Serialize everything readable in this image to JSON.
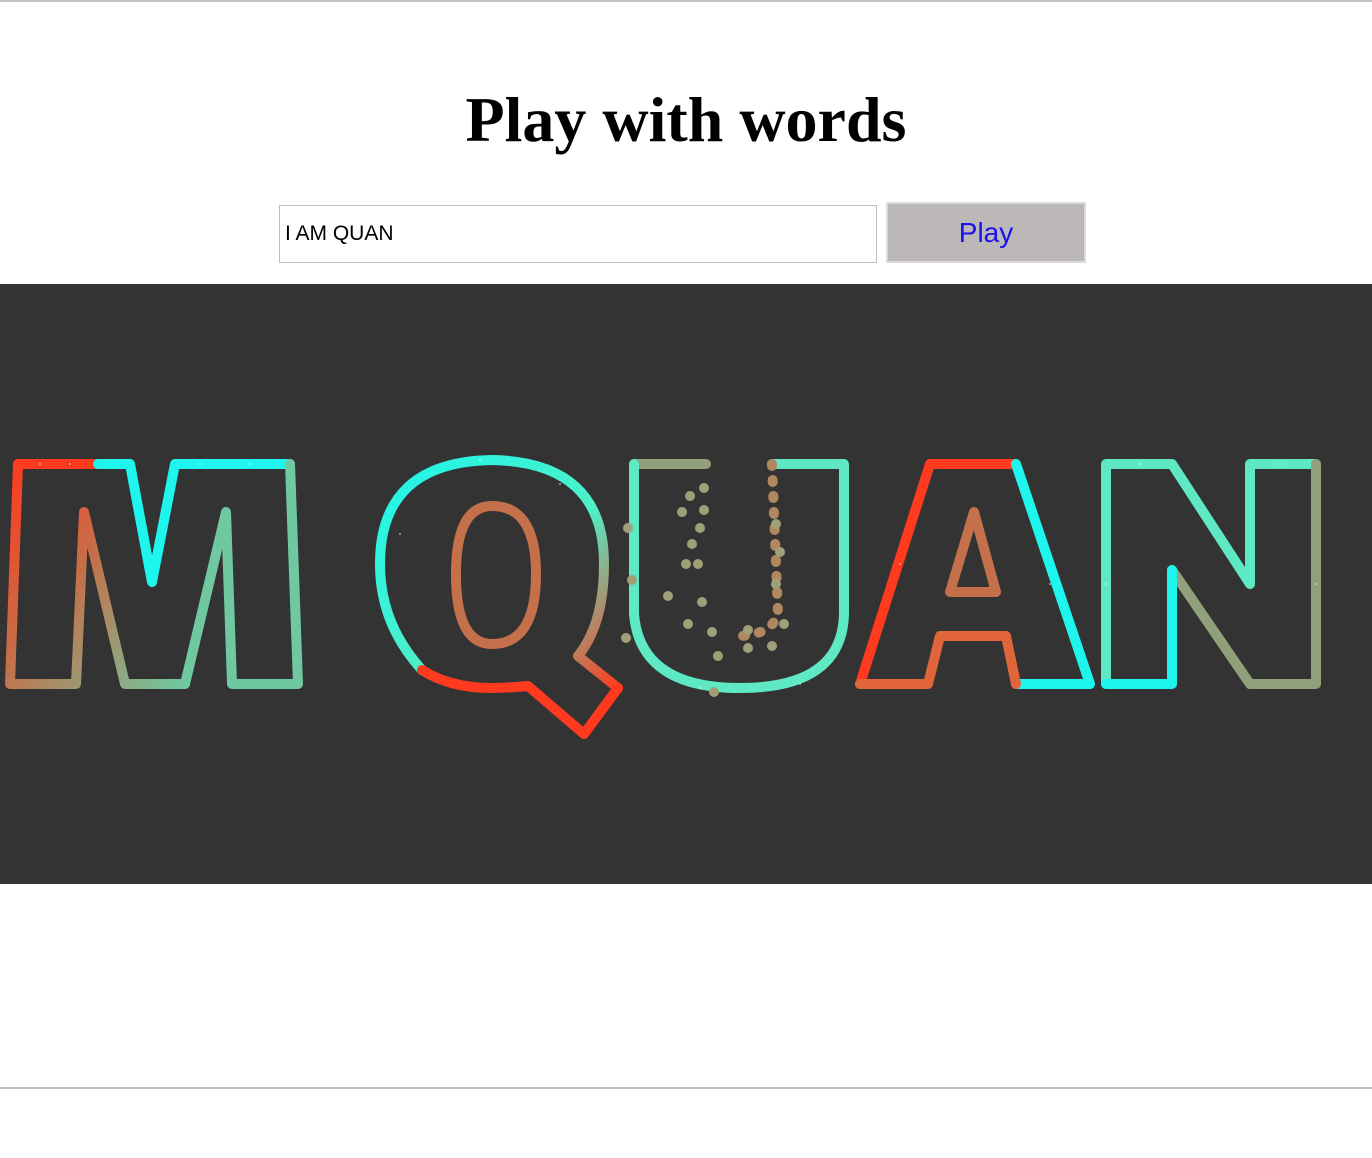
{
  "page": {
    "title": "Play with words"
  },
  "form": {
    "input_value": "I AM QUAN",
    "play_label": "Play"
  },
  "canvas": {
    "background": "#333333",
    "rendered_text": "I AM QUAN",
    "particle_colors": [
      "#ff3a1e",
      "#1ef5ec",
      "#4ef0c8",
      "#c4704a",
      "#8fa07a",
      "#e0653a"
    ]
  }
}
